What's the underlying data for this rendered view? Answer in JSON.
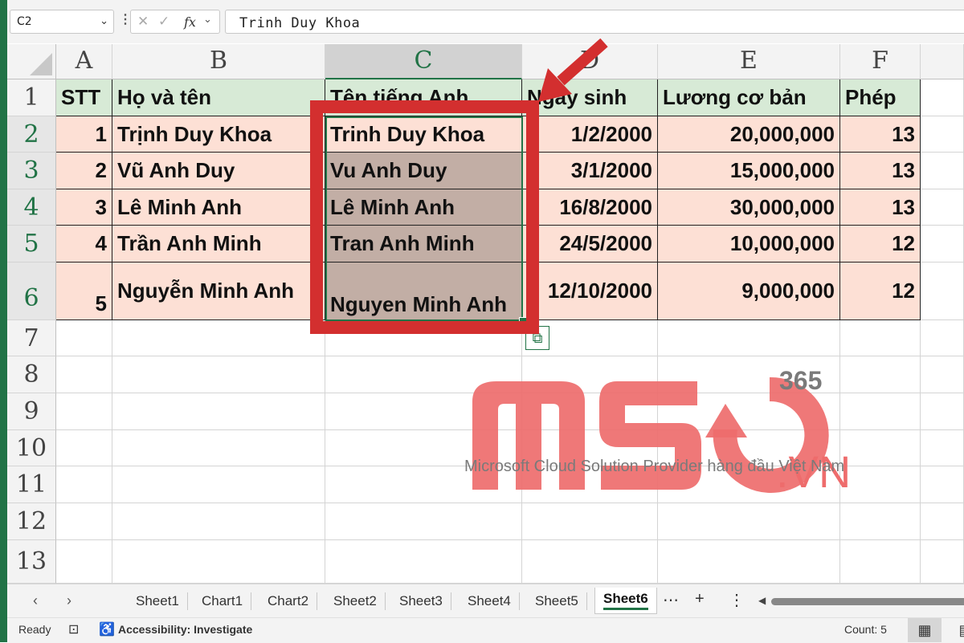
{
  "formula_bar": {
    "name_box": "C2",
    "fx_label": "fx",
    "content": "Trinh Duy Khoa"
  },
  "columns": [
    "A",
    "B",
    "C",
    "D",
    "E",
    "F"
  ],
  "rows": [
    "1",
    "2",
    "3",
    "4",
    "5",
    "6",
    "7",
    "8",
    "9",
    "10",
    "11",
    "12",
    "13"
  ],
  "header_row": [
    "STT",
    "Họ và tên",
    "Tên tiếng Anh",
    "Ngày sinh",
    "Lương cơ bản",
    "Phép"
  ],
  "data_rows": [
    [
      "1",
      "Trịnh Duy Khoa",
      "Trinh Duy Khoa",
      "1/2/2000",
      "20,000,000",
      "13"
    ],
    [
      "2",
      "Vũ Anh Duy",
      "Vu Anh Duy",
      "3/1/2000",
      "15,000,000",
      "13"
    ],
    [
      "3",
      "Lê Minh Anh",
      "Lê Minh Anh",
      "16/8/2000",
      "30,000,000",
      "13"
    ],
    [
      "4",
      "Trần Anh Minh",
      "Tran Anh Minh",
      "24/5/2000",
      "10,000,000",
      "12"
    ],
    [
      "5",
      "Nguyễn Minh Anh",
      "Nguyen Minh Anh",
      "12/10/2000",
      "9,000,000",
      "12"
    ]
  ],
  "watermark": {
    "brand": "MSO",
    "suffix": ".VN",
    "sup": "365",
    "tagline": "Microsoft Cloud Solution Provider hàng đầu Việt Nam"
  },
  "sheet_tabs": [
    "Sheet1",
    "Chart1",
    "Chart2",
    "Sheet2",
    "Sheet3",
    "Sheet4",
    "Sheet5",
    "Sheet6"
  ],
  "active_sheet": "Sheet6",
  "status_bar": {
    "ready": "Ready",
    "accessibility": "Accessibility: Investigate",
    "count": "Count: 5"
  },
  "colors": {
    "excel_green": "#217346",
    "header_fill": "#d7ead6",
    "data_fill": "#fde0d5",
    "selected_fill": "#c2aea5",
    "annotation_red": "#d32f2f",
    "watermark_pink": "#ee6c6c"
  }
}
